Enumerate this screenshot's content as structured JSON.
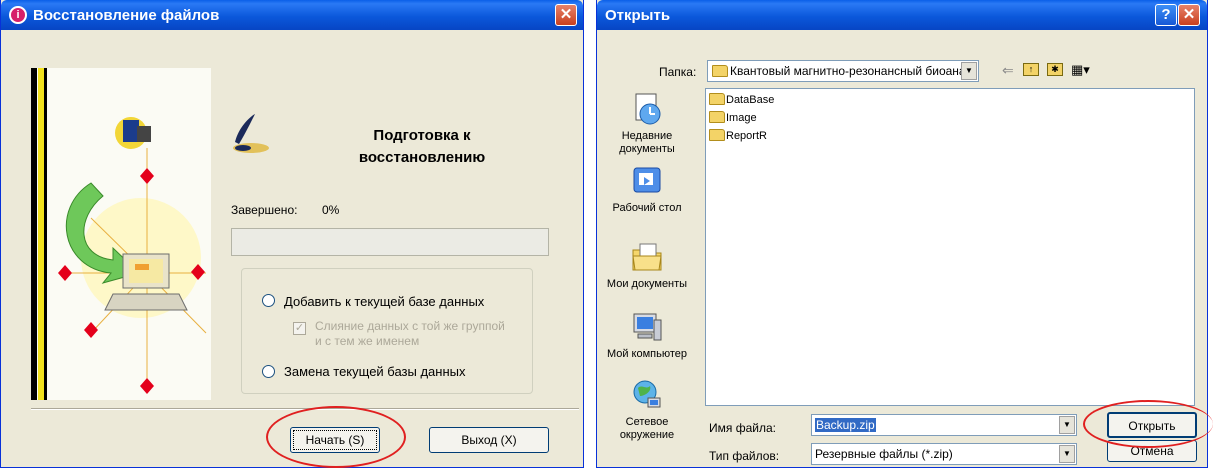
{
  "restore": {
    "title": "Восстановление файлов",
    "heading": "Подготовка к восстановлению",
    "completed_label": "Завершено:",
    "completed_value": "0%",
    "progress": 0,
    "option_add": "Добавить к текущей базе данных",
    "option_merge": "Слияние данных с той же группой и с тем же именем",
    "option_replace": "Замена текущей базы данных",
    "start_button": "Начать (S)",
    "exit_button": "Выход (X)"
  },
  "open_dialog": {
    "title": "Открыть",
    "folder_label": "Папка:",
    "folder_value": "Квантовый магнитно-резонансный биоана",
    "places": [
      {
        "label": "Недавние документы",
        "icon": "recent-documents-icon"
      },
      {
        "label": "Рабочий стол",
        "icon": "desktop-icon"
      },
      {
        "label": "Мои документы",
        "icon": "my-documents-icon"
      },
      {
        "label": "Мой компьютер",
        "icon": "my-computer-icon"
      },
      {
        "label": "Сетевое окружение",
        "icon": "network-icon"
      }
    ],
    "files": [
      "DataBase",
      "Image",
      "ReportR"
    ],
    "filename_label": "Имя файла:",
    "filename_value": "Backup.zip",
    "filetype_label": "Тип файлов:",
    "filetype_value": "Резервные файлы (*.zip)",
    "open_button": "Открыть",
    "cancel_button": "Отмена"
  },
  "colors": {
    "titlebar": "#0b58db",
    "window_bg": "#ece9d8",
    "highlight_ellipse": "#e02020",
    "selection": "#316ac5"
  }
}
